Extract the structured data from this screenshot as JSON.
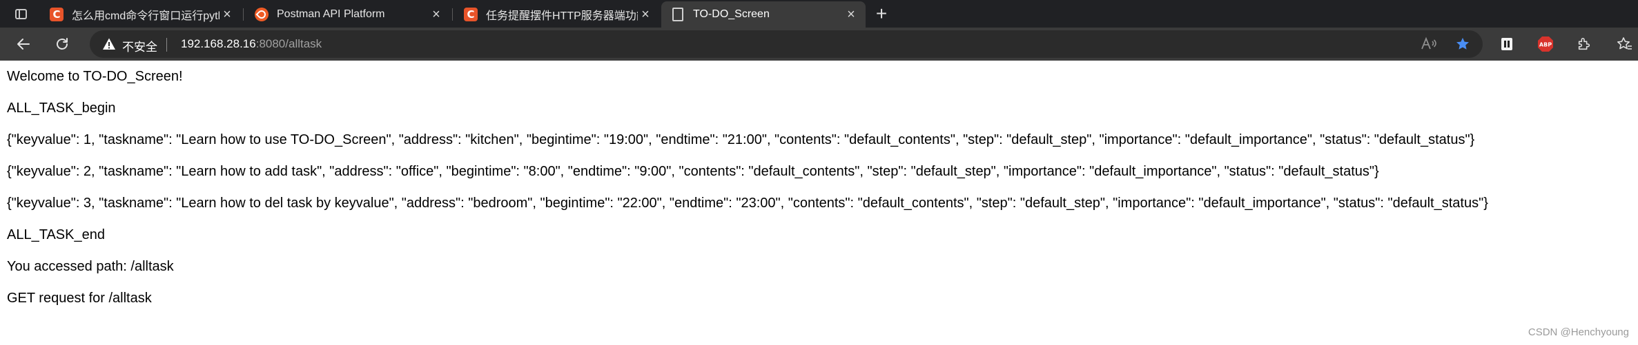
{
  "browser": {
    "tabs": [
      {
        "title": "怎么用cmd命令行窗口运行pyth",
        "icon": "csdn-icon",
        "active": false
      },
      {
        "title": "Postman API Platform",
        "icon": "postman-icon",
        "active": false
      },
      {
        "title": "任务提醒摆件HTTP服务器端功能",
        "icon": "csdn-icon",
        "active": false
      },
      {
        "title": "TO-DO_Screen",
        "icon": "document-icon",
        "active": true
      }
    ],
    "new_tab_label": "+",
    "address": {
      "security_label": "不安全",
      "host": "192.168.28.16",
      "path": ":8080/alltask"
    }
  },
  "page": {
    "lines": [
      "Welcome to TO-DO_Screen!",
      "ALL_TASK_begin",
      "{\"keyvalue\": 1, \"taskname\": \"Learn how to use TO-DO_Screen\", \"address\": \"kitchen\", \"begintime\": \"19:00\", \"endtime\": \"21:00\", \"contents\": \"default_contents\", \"step\": \"default_step\", \"importance\": \"default_importance\", \"status\": \"default_status\"}",
      "{\"keyvalue\": 2, \"taskname\": \"Learn how to add task\", \"address\": \"office\", \"begintime\": \"8:00\", \"endtime\": \"9:00\", \"contents\": \"default_contents\", \"step\": \"default_step\", \"importance\": \"default_importance\", \"status\": \"default_status\"}",
      "{\"keyvalue\": 3, \"taskname\": \"Learn how to del task by keyvalue\", \"address\": \"bedroom\", \"begintime\": \"22:00\", \"endtime\": \"23:00\", \"contents\": \"default_contents\", \"step\": \"default_step\", \"importance\": \"default_importance\", \"status\": \"default_status\"}",
      "ALL_TASK_end",
      "You accessed path: /alltask",
      "GET request for /alltask"
    ]
  },
  "watermark": "CSDN @Henchyoung",
  "colors": {
    "tab_strip": "#202124",
    "toolbar": "#3b3b3b",
    "omnibox": "#2b2b2b",
    "csdn_brand": "#e8542a",
    "postman_brand": "#ef5b25",
    "favorite_star": "#4a8ef5",
    "adblock_red": "#d8332c"
  }
}
